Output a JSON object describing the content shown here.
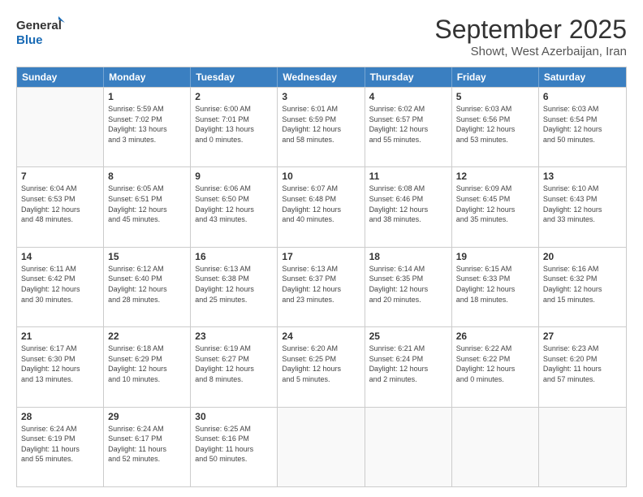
{
  "logo": {
    "line1": "General",
    "line2": "Blue"
  },
  "title": "September 2025",
  "subtitle": "Showt, West Azerbaijan, Iran",
  "days_of_week": [
    "Sunday",
    "Monday",
    "Tuesday",
    "Wednesday",
    "Thursday",
    "Friday",
    "Saturday"
  ],
  "weeks": [
    [
      {
        "day": null,
        "info": null
      },
      {
        "day": "1",
        "info": "Sunrise: 5:59 AM\nSunset: 7:02 PM\nDaylight: 13 hours\nand 3 minutes."
      },
      {
        "day": "2",
        "info": "Sunrise: 6:00 AM\nSunset: 7:01 PM\nDaylight: 13 hours\nand 0 minutes."
      },
      {
        "day": "3",
        "info": "Sunrise: 6:01 AM\nSunset: 6:59 PM\nDaylight: 12 hours\nand 58 minutes."
      },
      {
        "day": "4",
        "info": "Sunrise: 6:02 AM\nSunset: 6:57 PM\nDaylight: 12 hours\nand 55 minutes."
      },
      {
        "day": "5",
        "info": "Sunrise: 6:03 AM\nSunset: 6:56 PM\nDaylight: 12 hours\nand 53 minutes."
      },
      {
        "day": "6",
        "info": "Sunrise: 6:03 AM\nSunset: 6:54 PM\nDaylight: 12 hours\nand 50 minutes."
      }
    ],
    [
      {
        "day": "7",
        "info": "Sunrise: 6:04 AM\nSunset: 6:53 PM\nDaylight: 12 hours\nand 48 minutes."
      },
      {
        "day": "8",
        "info": "Sunrise: 6:05 AM\nSunset: 6:51 PM\nDaylight: 12 hours\nand 45 minutes."
      },
      {
        "day": "9",
        "info": "Sunrise: 6:06 AM\nSunset: 6:50 PM\nDaylight: 12 hours\nand 43 minutes."
      },
      {
        "day": "10",
        "info": "Sunrise: 6:07 AM\nSunset: 6:48 PM\nDaylight: 12 hours\nand 40 minutes."
      },
      {
        "day": "11",
        "info": "Sunrise: 6:08 AM\nSunset: 6:46 PM\nDaylight: 12 hours\nand 38 minutes."
      },
      {
        "day": "12",
        "info": "Sunrise: 6:09 AM\nSunset: 6:45 PM\nDaylight: 12 hours\nand 35 minutes."
      },
      {
        "day": "13",
        "info": "Sunrise: 6:10 AM\nSunset: 6:43 PM\nDaylight: 12 hours\nand 33 minutes."
      }
    ],
    [
      {
        "day": "14",
        "info": "Sunrise: 6:11 AM\nSunset: 6:42 PM\nDaylight: 12 hours\nand 30 minutes."
      },
      {
        "day": "15",
        "info": "Sunrise: 6:12 AM\nSunset: 6:40 PM\nDaylight: 12 hours\nand 28 minutes."
      },
      {
        "day": "16",
        "info": "Sunrise: 6:13 AM\nSunset: 6:38 PM\nDaylight: 12 hours\nand 25 minutes."
      },
      {
        "day": "17",
        "info": "Sunrise: 6:13 AM\nSunset: 6:37 PM\nDaylight: 12 hours\nand 23 minutes."
      },
      {
        "day": "18",
        "info": "Sunrise: 6:14 AM\nSunset: 6:35 PM\nDaylight: 12 hours\nand 20 minutes."
      },
      {
        "day": "19",
        "info": "Sunrise: 6:15 AM\nSunset: 6:33 PM\nDaylight: 12 hours\nand 18 minutes."
      },
      {
        "day": "20",
        "info": "Sunrise: 6:16 AM\nSunset: 6:32 PM\nDaylight: 12 hours\nand 15 minutes."
      }
    ],
    [
      {
        "day": "21",
        "info": "Sunrise: 6:17 AM\nSunset: 6:30 PM\nDaylight: 12 hours\nand 13 minutes."
      },
      {
        "day": "22",
        "info": "Sunrise: 6:18 AM\nSunset: 6:29 PM\nDaylight: 12 hours\nand 10 minutes."
      },
      {
        "day": "23",
        "info": "Sunrise: 6:19 AM\nSunset: 6:27 PM\nDaylight: 12 hours\nand 8 minutes."
      },
      {
        "day": "24",
        "info": "Sunrise: 6:20 AM\nSunset: 6:25 PM\nDaylight: 12 hours\nand 5 minutes."
      },
      {
        "day": "25",
        "info": "Sunrise: 6:21 AM\nSunset: 6:24 PM\nDaylight: 12 hours\nand 2 minutes."
      },
      {
        "day": "26",
        "info": "Sunrise: 6:22 AM\nSunset: 6:22 PM\nDaylight: 12 hours\nand 0 minutes."
      },
      {
        "day": "27",
        "info": "Sunrise: 6:23 AM\nSunset: 6:20 PM\nDaylight: 11 hours\nand 57 minutes."
      }
    ],
    [
      {
        "day": "28",
        "info": "Sunrise: 6:24 AM\nSunset: 6:19 PM\nDaylight: 11 hours\nand 55 minutes."
      },
      {
        "day": "29",
        "info": "Sunrise: 6:24 AM\nSunset: 6:17 PM\nDaylight: 11 hours\nand 52 minutes."
      },
      {
        "day": "30",
        "info": "Sunrise: 6:25 AM\nSunset: 6:16 PM\nDaylight: 11 hours\nand 50 minutes."
      },
      {
        "day": null,
        "info": null
      },
      {
        "day": null,
        "info": null
      },
      {
        "day": null,
        "info": null
      },
      {
        "day": null,
        "info": null
      }
    ]
  ]
}
